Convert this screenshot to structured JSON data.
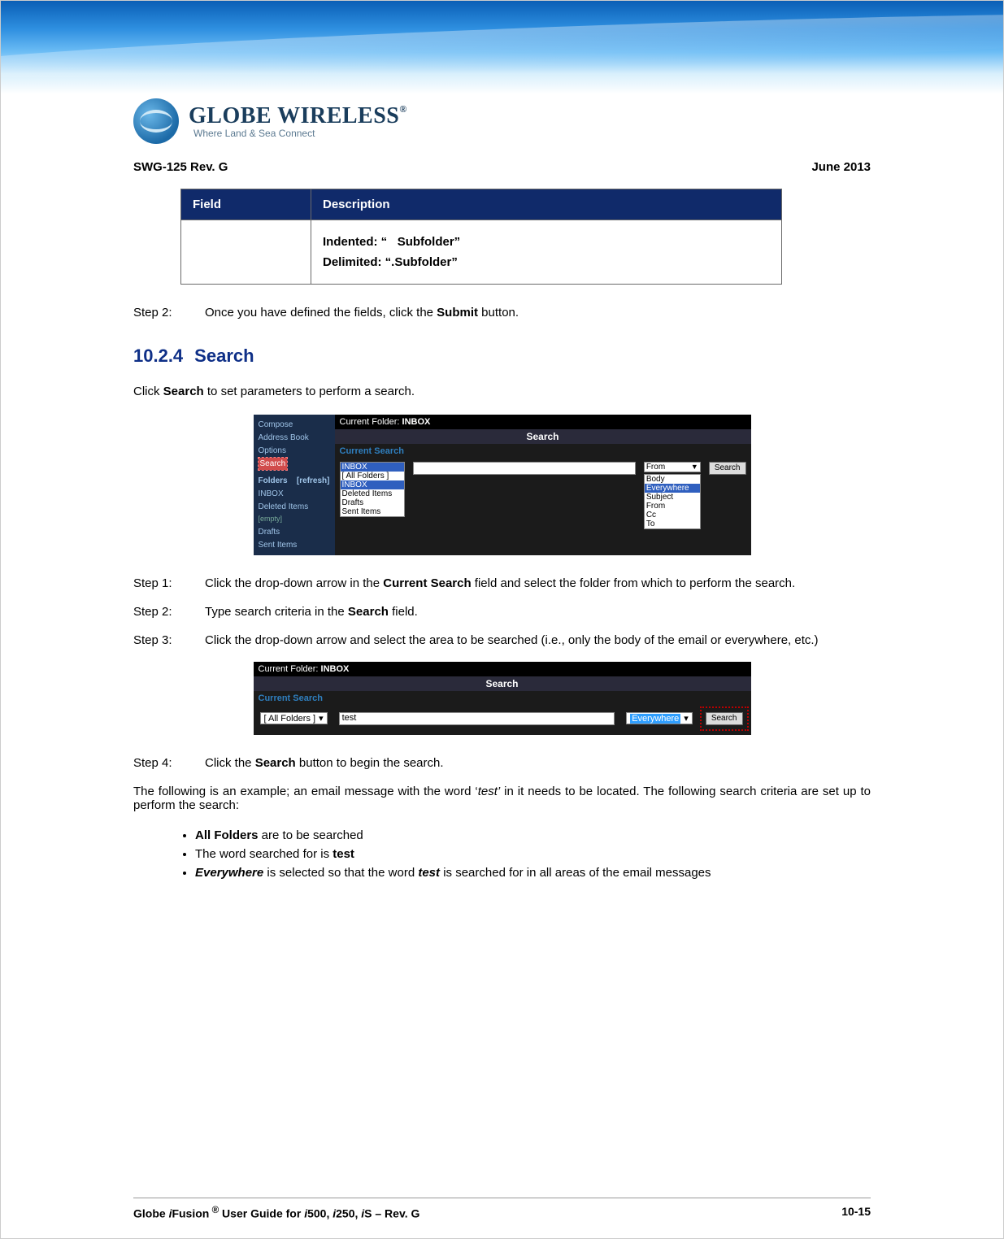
{
  "doc": {
    "rev": "SWG-125 Rev. G",
    "date": "June 2013"
  },
  "table": {
    "headers": {
      "field": "Field",
      "desc": "Description"
    },
    "row": {
      "field": "",
      "line1_label": "Indented: “",
      "line1_value": "Subfolder”",
      "line2_label": "Delimited: “.Subfolder”"
    }
  },
  "step_top": {
    "label": "Step  2:",
    "text_before": "Once you have defined the fields, click the ",
    "bold": "Submit",
    "text_after": " button."
  },
  "section": {
    "num": "10.2.4",
    "title": "Search"
  },
  "intro": {
    "before": "Click ",
    "bold": "Search",
    "after": " to set parameters to perform a search."
  },
  "shot1": {
    "sidebar": {
      "compose": "Compose",
      "addr": "Address Book",
      "options": "Options",
      "search": "Search",
      "folders_hdr": "Folders",
      "refresh": "[refresh]",
      "inbox": "INBOX",
      "deleted": "Deleted Items",
      "empty": "[empty]",
      "drafts": "Drafts",
      "sent": "Sent Items"
    },
    "cf_label": "Current Folder: ",
    "cf_value": "INBOX",
    "search_title": "Search",
    "cs_label": "Current Search",
    "listbox": {
      "sel": "INBOX",
      "all": "[ All Folders ]",
      "inbox": "INBOX",
      "del": "Deleted Items",
      "drafts": "Drafts",
      "sent": "Sent Items"
    },
    "dd": {
      "sel": "From",
      "body": "Body",
      "every": "Everywhere",
      "subject": "Subject",
      "from": "From",
      "cc": "Cc",
      "to": "To"
    },
    "search_btn": "Search"
  },
  "steps": {
    "s1": {
      "label": "Step  1:",
      "t1": "Click  the  drop-down  arrow  in  the  ",
      "b": "Current  Search",
      "t2": "  field  and  select  the  folder  from which to perform the search."
    },
    "s2": {
      "label": "Step  2:",
      "t1": "Type search criteria in the ",
      "b": "Search",
      "t2": " field."
    },
    "s3": {
      "label": "Step  3:",
      "text": "Click the drop-down arrow and select the area to be searched (i.e., only the body of the email or everywhere, etc.)"
    },
    "s4": {
      "label": "Step  4:",
      "t1": "Click the ",
      "b": "Search",
      "t2": " button to begin the search."
    }
  },
  "shot2": {
    "cf_label": "Current Folder: ",
    "cf_value": "INBOX",
    "search_title": "Search",
    "cs_label": "Current Search",
    "folder_sel": "[ All Folders ]",
    "text_val": "test",
    "scope_sel": "Everywhere",
    "search_btn": "Search"
  },
  "example": {
    "t1": "The following is an example; an email message with the word ‘",
    "i": "test’",
    "t2": " in it needs to be located. The following search criteria are set up to perform the search:"
  },
  "bullets": {
    "b1_bold": "All Folders",
    "b1_rest": " are to be searched",
    "b2_before": "The word searched for is ",
    "b2_bold": "test",
    "b3_bi1": "Everywhere",
    "b3_t1": "  is  selected  so  that  the  word  ",
    "b3_bi2": "test",
    "b3_t2": "  is  searched  for  in  all  areas  of  the  email messages"
  },
  "footer": {
    "left1": "Globe ",
    "left_i1": "i",
    "left2": "Fusion",
    "left_sup": " ®",
    "left3": " User Guide for ",
    "left_i2": "i",
    "left4": "500, ",
    "left_i3": "i",
    "left5": "250, ",
    "left_i4": "i",
    "left6": "S – Rev. G",
    "right": "10-15"
  },
  "logo": {
    "brand": "GLOBE WIRELESS",
    "reg": "®",
    "tagline": "Where Land & Sea Connect"
  }
}
